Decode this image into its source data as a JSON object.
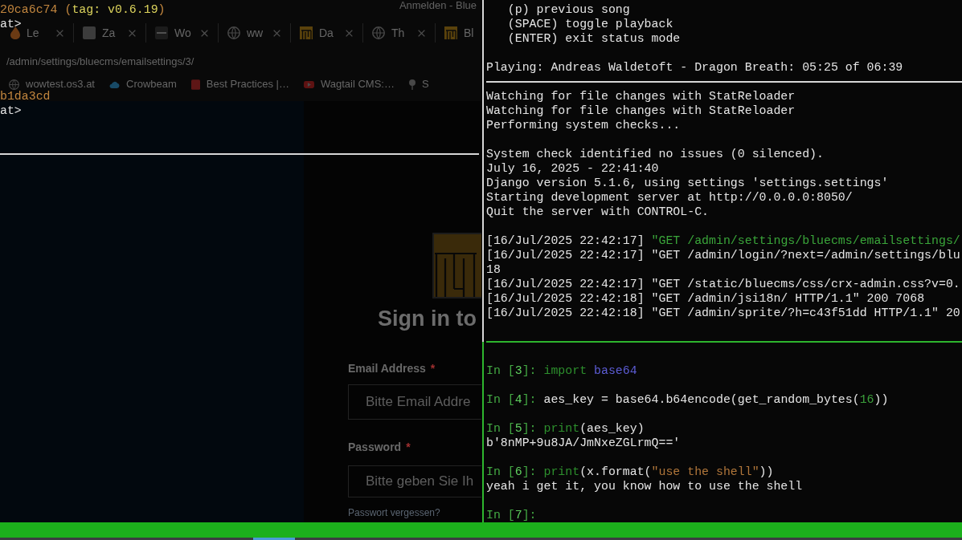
{
  "browser": {
    "title": "Anmelden - Blue",
    "tabs": [
      {
        "label": "Le",
        "kind": "drop"
      },
      {
        "label": "Za",
        "kind": "tile"
      },
      {
        "label": "Wo",
        "kind": "dash"
      },
      {
        "label": "ww",
        "kind": "globe"
      },
      {
        "label": "Da",
        "kind": "logo"
      },
      {
        "label": "Th",
        "kind": "globe"
      },
      {
        "label": "Bl",
        "kind": "logo"
      }
    ],
    "address": "/admin/settings/bluecms/emailsettings/3/",
    "bookmarks": [
      {
        "label": "wowtest.os3.at",
        "kind": "globe"
      },
      {
        "label": "Crowbeam",
        "kind": "cloud"
      },
      {
        "label": "Best Practices |…",
        "kind": "letter"
      },
      {
        "label": "Wagtail CMS:…",
        "kind": "video"
      },
      {
        "label": "S",
        "kind": "pin"
      }
    ],
    "login": {
      "heading": "Sign in to",
      "fields": [
        {
          "label": "Email Address",
          "mark": "*",
          "placeholder": "Bitte Email Addre"
        },
        {
          "label": "Password",
          "mark": "*",
          "placeholder": "Bitte geben Sie Ih"
        }
      ],
      "link": "Passwort vergessen?"
    }
  },
  "terminal": {
    "git_pane": {
      "lines": [
        {
          "kind": "text",
          "segments": [
            {
              "text": "20ca6c74",
              "kind": "commit"
            },
            {
              "text": " (",
              "kind": "commit"
            },
            {
              "text": "tag: v0.6.19",
              "kind": "tag"
            },
            {
              "text": ")",
              "kind": "commit"
            }
          ]
        },
        {
          "kind": "text",
          "segments": [
            {
              "text": "at>",
              "kind": "plain"
            }
          ]
        },
        {
          "kind": "blank"
        },
        {
          "kind": "blank"
        },
        {
          "kind": "blank"
        },
        {
          "kind": "blank"
        },
        {
          "kind": "text",
          "segments": [
            {
              "text": "b1da3cd",
              "kind": "commit"
            }
          ]
        },
        {
          "kind": "text",
          "segments": [
            {
              "text": "at>",
              "kind": "plain"
            }
          ]
        }
      ]
    },
    "player_pane": {
      "lines": [
        {
          "kind": "text",
          "segments": [
            {
              "text": "   (p) previous song",
              "kind": "plain"
            }
          ]
        },
        {
          "kind": "text",
          "segments": [
            {
              "text": "   (SPACE) toggle playback",
              "kind": "plain"
            }
          ]
        },
        {
          "kind": "text",
          "segments": [
            {
              "text": "   (ENTER) exit status mode",
              "kind": "plain"
            }
          ]
        },
        {
          "kind": "blank"
        },
        {
          "kind": "text",
          "segments": [
            {
              "text": "Playing: Andreas Waldetoft - Dragon Breath: 05:25 of 06:39",
              "kind": "plain"
            }
          ]
        }
      ]
    },
    "server_pane": {
      "lines": [
        {
          "kind": "text",
          "segments": [
            {
              "text": "Watching for file changes with StatReloader",
              "kind": "plain"
            }
          ]
        },
        {
          "kind": "text",
          "segments": [
            {
              "text": "Watching for file changes with StatReloader",
              "kind": "plain"
            }
          ]
        },
        {
          "kind": "text",
          "segments": [
            {
              "text": "Performing system checks...",
              "kind": "plain"
            }
          ]
        },
        {
          "kind": "blank"
        },
        {
          "kind": "text",
          "segments": [
            {
              "text": "System check identified no issues (0 silenced).",
              "kind": "plain"
            }
          ]
        },
        {
          "kind": "text",
          "segments": [
            {
              "text": "July 16, 2025 - 22:41:40",
              "kind": "plain"
            }
          ]
        },
        {
          "kind": "text",
          "segments": [
            {
              "text": "Django version 5.1.6, using settings 'settings.settings'",
              "kind": "plain"
            }
          ]
        },
        {
          "kind": "text",
          "segments": [
            {
              "text": "Starting development server at http://0.0.0.0:8050/",
              "kind": "plain"
            }
          ]
        },
        {
          "kind": "text",
          "segments": [
            {
              "text": "Quit the server with CONTROL-C.",
              "kind": "plain"
            }
          ]
        },
        {
          "kind": "blank"
        },
        {
          "kind": "text",
          "segments": [
            {
              "text": "[16/Jul/2025 22:42:17] ",
              "kind": "plain"
            },
            {
              "text": "\"GET /admin/settings/bluecms/emailsettings/",
              "kind": "redirect"
            }
          ]
        },
        {
          "kind": "text",
          "segments": [
            {
              "text": "[16/Jul/2025 22:42:17] \"GET /admin/login/?next=/admin/settings/blu",
              "kind": "plain"
            }
          ]
        },
        {
          "kind": "text",
          "segments": [
            {
              "text": "18",
              "kind": "plain"
            }
          ]
        },
        {
          "kind": "text",
          "segments": [
            {
              "text": "[16/Jul/2025 22:42:17] \"GET /static/bluecms/css/crx-admin.css?v=0.",
              "kind": "plain"
            }
          ]
        },
        {
          "kind": "text",
          "segments": [
            {
              "text": "[16/Jul/2025 22:42:18] \"GET /admin/jsi18n/ HTTP/1.1\" 200 7068",
              "kind": "plain"
            }
          ]
        },
        {
          "kind": "text",
          "segments": [
            {
              "text": "[16/Jul/2025 22:42:18] \"GET /admin/sprite/?h=c43f51dd HTTP/1.1\" 20",
              "kind": "plain"
            }
          ]
        }
      ]
    },
    "ipython_pane": {
      "lines": [
        {
          "kind": "blank"
        },
        {
          "kind": "text",
          "segments": [
            {
              "text": "In [",
              "kind": "prompt"
            },
            {
              "text": "3",
              "kind": "prompt_number"
            },
            {
              "text": "]: ",
              "kind": "prompt"
            },
            {
              "text": "import",
              "kind": "keyword"
            },
            {
              "text": " base64",
              "kind": "module"
            }
          ]
        },
        {
          "kind": "blank"
        },
        {
          "kind": "text",
          "segments": [
            {
              "text": "In [",
              "kind": "prompt"
            },
            {
              "text": "4",
              "kind": "prompt_number"
            },
            {
              "text": "]: ",
              "kind": "prompt"
            },
            {
              "text": "aes_key = base64.b64encode(get_random_bytes(",
              "kind": "plain"
            },
            {
              "text": "16",
              "kind": "number"
            },
            {
              "text": "))",
              "kind": "plain"
            }
          ]
        },
        {
          "kind": "blank"
        },
        {
          "kind": "text",
          "segments": [
            {
              "text": "In [",
              "kind": "prompt"
            },
            {
              "text": "5",
              "kind": "prompt_number"
            },
            {
              "text": "]: ",
              "kind": "prompt"
            },
            {
              "text": "print",
              "kind": "keyword"
            },
            {
              "text": "(aes_key)",
              "kind": "plain"
            }
          ]
        },
        {
          "kind": "text",
          "segments": [
            {
              "text": "b'8nMP+9u8JA/JmNxeZGLrmQ=='",
              "kind": "plain"
            }
          ]
        },
        {
          "kind": "blank"
        },
        {
          "kind": "text",
          "segments": [
            {
              "text": "In [",
              "kind": "prompt"
            },
            {
              "text": "6",
              "kind": "prompt_number"
            },
            {
              "text": "]: ",
              "kind": "prompt"
            },
            {
              "text": "print",
              "kind": "keyword"
            },
            {
              "text": "(x.format(",
              "kind": "plain"
            },
            {
              "text": "\"use the shell\"",
              "kind": "string"
            },
            {
              "text": "))",
              "kind": "plain"
            }
          ]
        },
        {
          "kind": "text",
          "segments": [
            {
              "text": "yeah i get it, you know how to use the shell",
              "kind": "plain"
            }
          ]
        },
        {
          "kind": "blank"
        },
        {
          "kind": "text",
          "segments": [
            {
              "text": "In [",
              "kind": "prompt"
            },
            {
              "text": "7",
              "kind": "prompt_number"
            },
            {
              "text": "]:",
              "kind": "prompt"
            }
          ]
        }
      ]
    }
  }
}
